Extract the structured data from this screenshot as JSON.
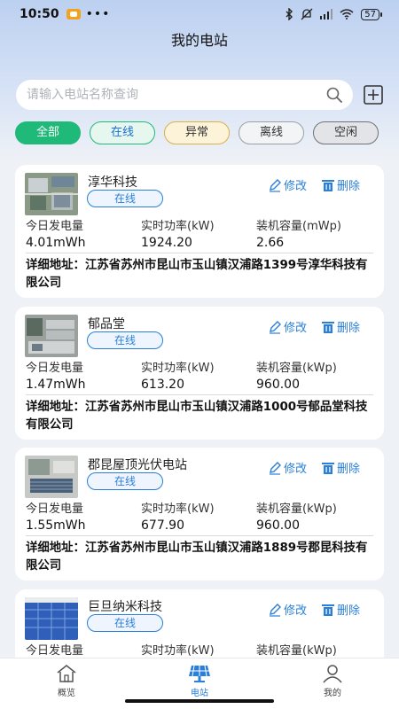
{
  "status_bar": {
    "time": "10:50",
    "battery": "57"
  },
  "header": {
    "title": "我的电站"
  },
  "search": {
    "placeholder": "请输入电站名称查询"
  },
  "filters": [
    {
      "label": "全部",
      "selected": true
    },
    {
      "label": "在线"
    },
    {
      "label": "异常"
    },
    {
      "label": "离线"
    },
    {
      "label": "空闲"
    }
  ],
  "actions": {
    "edit": "修改",
    "delete": "删除"
  },
  "stations": [
    {
      "name": "淳华科技",
      "status": "在线",
      "labels": [
        "今日发电量",
        "实时功率(kW)",
        "装机容量(mWp)"
      ],
      "values": [
        "4.01mWh",
        "1924.20",
        "2.66"
      ],
      "address": "详细地址：江苏省苏州市昆山市玉山镇汉浦路1399号淳华科技有限公司"
    },
    {
      "name": "郁品堂",
      "status": "在线",
      "labels": [
        "今日发电量",
        "实时功率(kW)",
        "装机容量(kWp)"
      ],
      "values": [
        "1.47mWh",
        "613.20",
        "960.00"
      ],
      "address": "详细地址：江苏省苏州市昆山市玉山镇汉浦路1000号郁品堂科技有限公司"
    },
    {
      "name": "郡昆屋顶光伏电站",
      "status": "在线",
      "labels": [
        "今日发电量",
        "实时功率(kW)",
        "装机容量(kWp)"
      ],
      "values": [
        "1.55mWh",
        "677.90",
        "960.00"
      ],
      "address": "详细地址：江苏省苏州市昆山市玉山镇汉浦路1889号郡昆科技有限公司"
    },
    {
      "name": "巨旦纳米科技",
      "status": "在线",
      "labels": [
        "今日发电量",
        "实时功率(kW)",
        "装机容量(kWp)"
      ],
      "values": [
        "",
        "",
        ""
      ],
      "address": ""
    }
  ],
  "bottom_nav": [
    {
      "label": "概览",
      "icon": "home-icon"
    },
    {
      "label": "电站",
      "icon": "solar-panel-icon",
      "active": true
    },
    {
      "label": "我的",
      "icon": "user-icon"
    }
  ],
  "colors": {
    "accent": "#1fb97a",
    "link": "#2a7fd8"
  }
}
